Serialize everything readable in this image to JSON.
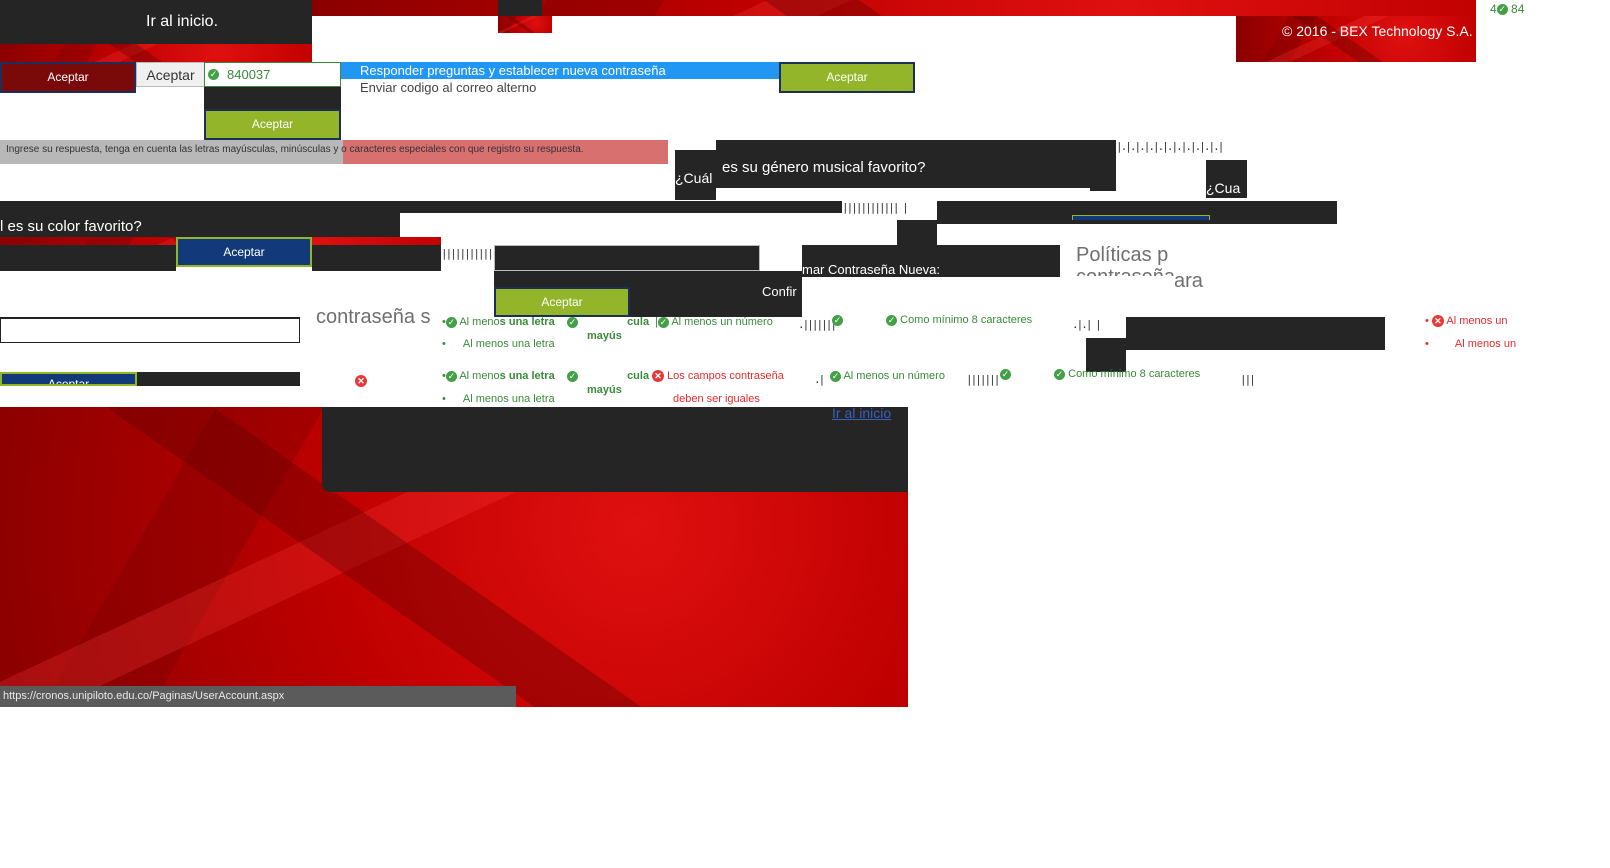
{
  "header": {
    "home_link": "Ir al inicio.",
    "copyright": "© 2016 - BEX Technology S.A."
  },
  "buttons": {
    "aceptar": "Aceptar",
    "aceptar_plain": "Aceptar"
  },
  "code_input": {
    "value": "840037",
    "partial_value": "84"
  },
  "options": {
    "option_1": "Responder preguntas y establecer nueva contraseña",
    "option_2": "Enviar codigo al correo alterno"
  },
  "hint": "Ingrese su respuesta, tenga en cuenta las letras mayúsculas, minúsculas y o caracteres especiales con que registro su respuesta.",
  "questions": {
    "q_genre": "es su género musical favorito?",
    "q_prefix": "¿Cuál",
    "q_prefix_2": "¿Cua",
    "q_color": "l es su color favorito?"
  },
  "password": {
    "confirm_label": "mar Contraseña Nueva:",
    "confirm_label_2": "Confir",
    "policies_title": "Políticas p",
    "policies_sub": "contraseña",
    "policies_frag_1": "ara",
    "policies_frag_2": "contraseña s"
  },
  "rules": {
    "r1_prefix": "Al meno",
    "r1_suffix": "s una letra",
    "r2": "Al menos una letra",
    "mayus": "mayús",
    "cula": "cula",
    "num": "Al menos un núme",
    "num_suffix": "ro",
    "min8": "Como mínimo 8 caracteres",
    "al_menos_un": "Al menos un",
    "mismatch_1": "Los campos contraseña",
    "mismatch_2": "deben ser iguales"
  },
  "footer": {
    "home_link": "Ir al inicio",
    "status_url": "https://cronos.unipiloto.edu.co/Paginas/UserAccount.aspx"
  },
  "colors": {
    "accent_green": "#93b52a",
    "navy": "#123a7a",
    "brand_red": "#c00000",
    "selected_blue": "#2196f3"
  }
}
